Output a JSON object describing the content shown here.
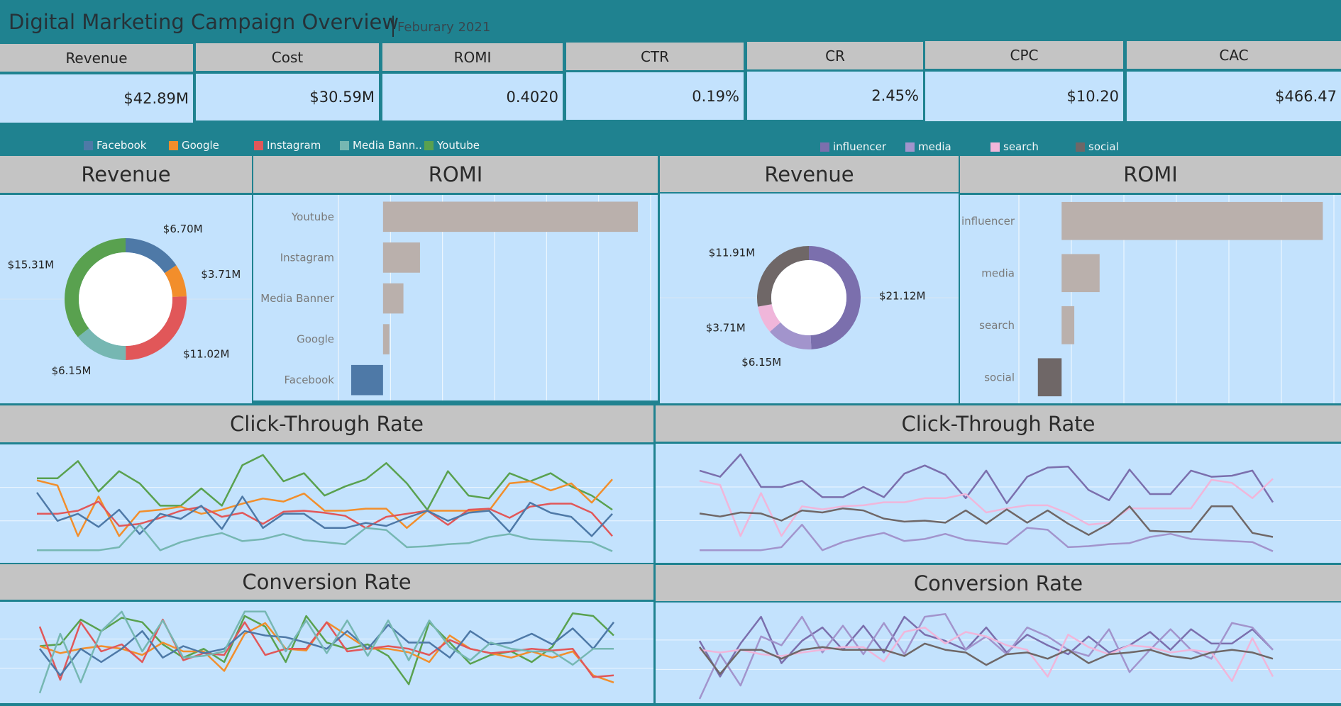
{
  "header": {
    "title": "Digital Marketing Campaign Overview",
    "subtitle": "Feburary 2021"
  },
  "kpis": [
    {
      "label": "Revenue",
      "value": "$42.89M"
    },
    {
      "label": "Cost",
      "value": "$30.59M"
    },
    {
      "label": "ROMI",
      "value": "0.4020"
    },
    {
      "label": "CTR",
      "value": "0.19%"
    },
    {
      "label": "CR",
      "value": "2.45%"
    },
    {
      "label": "CPC",
      "value": "$10.20"
    },
    {
      "label": "CAC",
      "value": "$466.47"
    }
  ],
  "colors": {
    "Facebook": "#4e79a7",
    "Google": "#f28e2b",
    "Instagram": "#e15759",
    "Media Banner": "#76b7b2",
    "Youtube": "#59a14f",
    "influencer": "#7b6fad",
    "media": "#a294cc",
    "search": "#f0b6da",
    "social": "#6f6767",
    "highlight_bar": "#4e79a7",
    "dim_bar": "#bab0ac"
  },
  "legend_left": [
    {
      "name": "Facebook",
      "label": "Facebook"
    },
    {
      "name": "Google",
      "label": "Google"
    },
    {
      "name": "Instagram",
      "label": "Instagram"
    },
    {
      "name": "Media Banner",
      "label": "Media Bann.."
    },
    {
      "name": "Youtube",
      "label": "Youtube"
    }
  ],
  "legend_right": [
    {
      "name": "influencer",
      "label": "influencer"
    },
    {
      "name": "media",
      "label": "media"
    },
    {
      "name": "search",
      "label": "search"
    },
    {
      "name": "social",
      "label": "social"
    }
  ],
  "sections": {
    "revenue": "Revenue",
    "romi": "ROMI",
    "ctr": "Click-Through Rate",
    "cr": "Conversion Rate"
  },
  "chart_data": [
    {
      "id": "revenue_by_channel",
      "type": "pie",
      "title": "Revenue",
      "slices": [
        {
          "name": "Facebook",
          "value": 6.7,
          "label": "$6.70M"
        },
        {
          "name": "Google",
          "value": 3.71,
          "label": "$3.71M"
        },
        {
          "name": "Instagram",
          "value": 11.02,
          "label": "$11.02M"
        },
        {
          "name": "Media Banner",
          "value": 6.15,
          "label": "$6.15M"
        },
        {
          "name": "Youtube",
          "value": 15.31,
          "label": "$15.31M"
        }
      ]
    },
    {
      "id": "romi_by_channel",
      "type": "bar",
      "title": "ROMI",
      "orientation": "horizontal",
      "categories": [
        "Youtube",
        "Instagram",
        "Media Banner",
        "Google",
        "Facebook"
      ],
      "values": [
        2.0,
        0.29,
        0.16,
        0.05,
        -0.25
      ],
      "xlim": [
        -0.35,
        2.1
      ],
      "grid": true
    },
    {
      "id": "revenue_by_type",
      "type": "pie",
      "title": "Revenue",
      "slices": [
        {
          "name": "influencer",
          "value": 21.12,
          "label": "$21.12M"
        },
        {
          "name": "media",
          "value": 6.15,
          "label": "$6.15M"
        },
        {
          "name": "search",
          "value": 3.71,
          "label": "$3.71M"
        },
        {
          "name": "social",
          "value": 11.91,
          "label": "$11.91M"
        }
      ]
    },
    {
      "id": "romi_by_type",
      "type": "bar",
      "title": "ROMI",
      "orientation": "horizontal",
      "categories": [
        "influencer",
        "media",
        "search",
        "social"
      ],
      "values": [
        1.65,
        0.24,
        0.08,
        -0.15
      ],
      "xlim": [
        -0.27,
        1.72
      ],
      "grid": true
    },
    {
      "id": "ctr_by_channel",
      "type": "line",
      "title": "Click-Through Rate",
      "ylim": [
        0,
        1
      ],
      "grid": true,
      "x": [
        1,
        2,
        3,
        4,
        5,
        6,
        7,
        8,
        9,
        10,
        11,
        12,
        13,
        14,
        15,
        16,
        17,
        18,
        19,
        20,
        21,
        22,
        23,
        24,
        25,
        26,
        27,
        28,
        29
      ],
      "series": [
        {
          "name": "Youtube",
          "values": [
            0.75,
            0.75,
            0.92,
            0.62,
            0.82,
            0.7,
            0.48,
            0.48,
            0.65,
            0.48,
            0.88,
            0.98,
            0.72,
            0.8,
            0.58,
            0.67,
            0.74,
            0.9,
            0.7,
            0.44,
            0.82,
            0.58,
            0.55,
            0.8,
            0.72,
            0.8,
            0.67,
            0.58,
            0.44
          ]
        },
        {
          "name": "Google",
          "values": [
            0.73,
            0.68,
            0.18,
            0.57,
            0.18,
            0.42,
            0.44,
            0.47,
            0.4,
            0.44,
            0.5,
            0.55,
            0.52,
            0.6,
            0.43,
            0.43,
            0.45,
            0.45,
            0.26,
            0.43,
            0.43,
            0.43,
            0.43,
            0.7,
            0.72,
            0.63,
            0.7,
            0.51,
            0.74
          ]
        },
        {
          "name": "Instagram",
          "values": [
            0.4,
            0.4,
            0.43,
            0.52,
            0.28,
            0.3,
            0.36,
            0.43,
            0.47,
            0.37,
            0.41,
            0.3,
            0.42,
            0.43,
            0.41,
            0.38,
            0.26,
            0.37,
            0.4,
            0.43,
            0.29,
            0.44,
            0.45,
            0.36,
            0.47,
            0.5,
            0.5,
            0.41,
            0.18
          ]
        },
        {
          "name": "Facebook",
          "values": [
            0.61,
            0.33,
            0.4,
            0.27,
            0.44,
            0.2,
            0.4,
            0.35,
            0.48,
            0.25,
            0.57,
            0.26,
            0.4,
            0.4,
            0.26,
            0.26,
            0.31,
            0.28,
            0.36,
            0.43,
            0.33,
            0.41,
            0.43,
            0.22,
            0.51,
            0.41,
            0.37,
            0.18,
            0.4
          ]
        },
        {
          "name": "Media Banner",
          "values": [
            0.04,
            0.04,
            0.04,
            0.04,
            0.07,
            0.29,
            0.04,
            0.12,
            0.17,
            0.21,
            0.13,
            0.15,
            0.2,
            0.14,
            0.12,
            0.1,
            0.26,
            0.24,
            0.07,
            0.08,
            0.1,
            0.11,
            0.17,
            0.2,
            0.15,
            0.14,
            0.13,
            0.12,
            0.03
          ]
        }
      ]
    },
    {
      "id": "ctr_by_type",
      "type": "line",
      "title": "Click-Through Rate",
      "ylim": [
        0,
        1
      ],
      "grid": true,
      "x": [
        1,
        2,
        3,
        4,
        5,
        6,
        7,
        8,
        9,
        10,
        11,
        12,
        13,
        14,
        15,
        16,
        17,
        18,
        19,
        20,
        21,
        22,
        23,
        24,
        25,
        26,
        27,
        28,
        29
      ],
      "series": [
        {
          "name": "influencer",
          "values": [
            0.82,
            0.76,
            0.98,
            0.66,
            0.66,
            0.72,
            0.56,
            0.56,
            0.66,
            0.56,
            0.79,
            0.87,
            0.78,
            0.55,
            0.82,
            0.5,
            0.76,
            0.85,
            0.86,
            0.63,
            0.53,
            0.83,
            0.59,
            0.59,
            0.82,
            0.76,
            0.77,
            0.82,
            0.51
          ]
        },
        {
          "name": "search",
          "values": [
            0.72,
            0.68,
            0.18,
            0.6,
            0.18,
            0.47,
            0.44,
            0.47,
            0.48,
            0.51,
            0.51,
            0.55,
            0.55,
            0.59,
            0.41,
            0.45,
            0.48,
            0.48,
            0.4,
            0.29,
            0.31,
            0.45,
            0.45,
            0.45,
            0.45,
            0.73,
            0.7,
            0.55,
            0.74
          ]
        },
        {
          "name": "social",
          "values": [
            0.4,
            0.37,
            0.41,
            0.4,
            0.33,
            0.43,
            0.41,
            0.45,
            0.43,
            0.35,
            0.32,
            0.33,
            0.31,
            0.43,
            0.3,
            0.44,
            0.31,
            0.43,
            0.3,
            0.19,
            0.3,
            0.47,
            0.23,
            0.22,
            0.22,
            0.47,
            0.47,
            0.21,
            0.17
          ]
        },
        {
          "name": "media",
          "values": [
            0.04,
            0.04,
            0.04,
            0.04,
            0.07,
            0.29,
            0.04,
            0.12,
            0.17,
            0.21,
            0.13,
            0.15,
            0.2,
            0.14,
            0.12,
            0.1,
            0.26,
            0.24,
            0.07,
            0.08,
            0.1,
            0.11,
            0.17,
            0.2,
            0.15,
            0.14,
            0.13,
            0.12,
            0.03
          ]
        }
      ]
    },
    {
      "id": "cr_by_channel",
      "type": "line",
      "title": "Conversion Rate",
      "ylim": [
        0,
        1
      ],
      "grid": true,
      "x": [
        1,
        2,
        3,
        4,
        5,
        6,
        7,
        8,
        9,
        10,
        11,
        12,
        13,
        14,
        15,
        16,
        17,
        18,
        19,
        20,
        21,
        22,
        23,
        24,
        25,
        26,
        27,
        28,
        29
      ],
      "series": [
        {
          "name": "Youtube",
          "values": [
            0.58,
            0.6,
            0.88,
            0.75,
            0.9,
            0.85,
            0.6,
            0.45,
            0.55,
            0.4,
            0.92,
            0.8,
            0.4,
            0.92,
            0.62,
            0.55,
            0.6,
            0.47,
            0.15,
            0.85,
            0.62,
            0.38,
            0.48,
            0.52,
            0.4,
            0.57,
            0.95,
            0.92,
            0.7
          ]
        },
        {
          "name": "Google",
          "values": [
            0.58,
            0.5,
            0.55,
            0.58,
            0.55,
            0.48,
            0.62,
            0.52,
            0.52,
            0.3,
            0.72,
            0.84,
            0.55,
            0.53,
            0.85,
            0.7,
            0.55,
            0.55,
            0.51,
            0.4,
            0.7,
            0.55,
            0.5,
            0.45,
            0.52,
            0.45,
            0.52,
            0.25,
            0.17
          ]
        },
        {
          "name": "Instagram",
          "values": [
            0.8,
            0.2,
            0.85,
            0.52,
            0.6,
            0.4,
            0.88,
            0.42,
            0.5,
            0.48,
            0.85,
            0.48,
            0.55,
            0.55,
            0.85,
            0.52,
            0.55,
            0.58,
            0.55,
            0.48,
            0.65,
            0.55,
            0.5,
            0.52,
            0.55,
            0.53,
            0.55,
            0.23,
            0.25
          ]
        },
        {
          "name": "Facebook",
          "values": [
            0.55,
            0.25,
            0.55,
            0.4,
            0.55,
            0.75,
            0.45,
            0.58,
            0.5,
            0.55,
            0.75,
            0.7,
            0.68,
            0.62,
            0.55,
            0.75,
            0.55,
            0.82,
            0.62,
            0.62,
            0.45,
            0.75,
            0.6,
            0.62,
            0.72,
            0.6,
            0.78,
            0.55,
            0.85
          ]
        },
        {
          "name": "Media Banner",
          "values": [
            0.05,
            0.72,
            0.17,
            0.75,
            0.97,
            0.52,
            0.87,
            0.45,
            0.47,
            0.52,
            0.97,
            0.97,
            0.52,
            0.87,
            0.5,
            0.87,
            0.47,
            0.87,
            0.42,
            0.87,
            0.57,
            0.42,
            0.62,
            0.55,
            0.52,
            0.52,
            0.37,
            0.55,
            0.55
          ]
        }
      ]
    },
    {
      "id": "cr_by_type",
      "type": "line",
      "title": "Conversion Rate",
      "ylim": [
        0,
        1
      ],
      "grid": true,
      "x": [
        1,
        2,
        3,
        4,
        5,
        6,
        7,
        8,
        9,
        10,
        11,
        12,
        13,
        14,
        15,
        16,
        17,
        18,
        19,
        20,
        21,
        22,
        23,
        24,
        25,
        26,
        27,
        28,
        29
      ],
      "series": [
        {
          "name": "influencer",
          "values": [
            0.65,
            0.25,
            0.62,
            0.92,
            0.4,
            0.65,
            0.8,
            0.55,
            0.82,
            0.52,
            0.92,
            0.72,
            0.65,
            0.55,
            0.8,
            0.52,
            0.72,
            0.6,
            0.5,
            0.7,
            0.52,
            0.6,
            0.75,
            0.55,
            0.78,
            0.62,
            0.62,
            0.78,
            0.55
          ]
        },
        {
          "name": "media",
          "values": [
            0.0,
            0.5,
            0.15,
            0.7,
            0.6,
            0.92,
            0.52,
            0.82,
            0.5,
            0.85,
            0.5,
            0.92,
            0.95,
            0.55,
            0.7,
            0.5,
            0.8,
            0.7,
            0.55,
            0.48,
            0.78,
            0.3,
            0.55,
            0.78,
            0.55,
            0.45,
            0.85,
            0.8,
            0.55
          ]
        },
        {
          "name": "search",
          "values": [
            0.55,
            0.52,
            0.55,
            0.5,
            0.48,
            0.52,
            0.55,
            0.58,
            0.58,
            0.42,
            0.75,
            0.8,
            0.62,
            0.75,
            0.7,
            0.6,
            0.55,
            0.25,
            0.72,
            0.58,
            0.5,
            0.6,
            0.58,
            0.52,
            0.55,
            0.52,
            0.2,
            0.68,
            0.25
          ]
        },
        {
          "name": "social",
          "values": [
            0.58,
            0.28,
            0.55,
            0.55,
            0.45,
            0.55,
            0.58,
            0.55,
            0.55,
            0.55,
            0.48,
            0.62,
            0.55,
            0.52,
            0.38,
            0.5,
            0.52,
            0.45,
            0.55,
            0.4,
            0.5,
            0.52,
            0.55,
            0.48,
            0.45,
            0.52,
            0.55,
            0.52,
            0.45
          ]
        }
      ]
    }
  ]
}
